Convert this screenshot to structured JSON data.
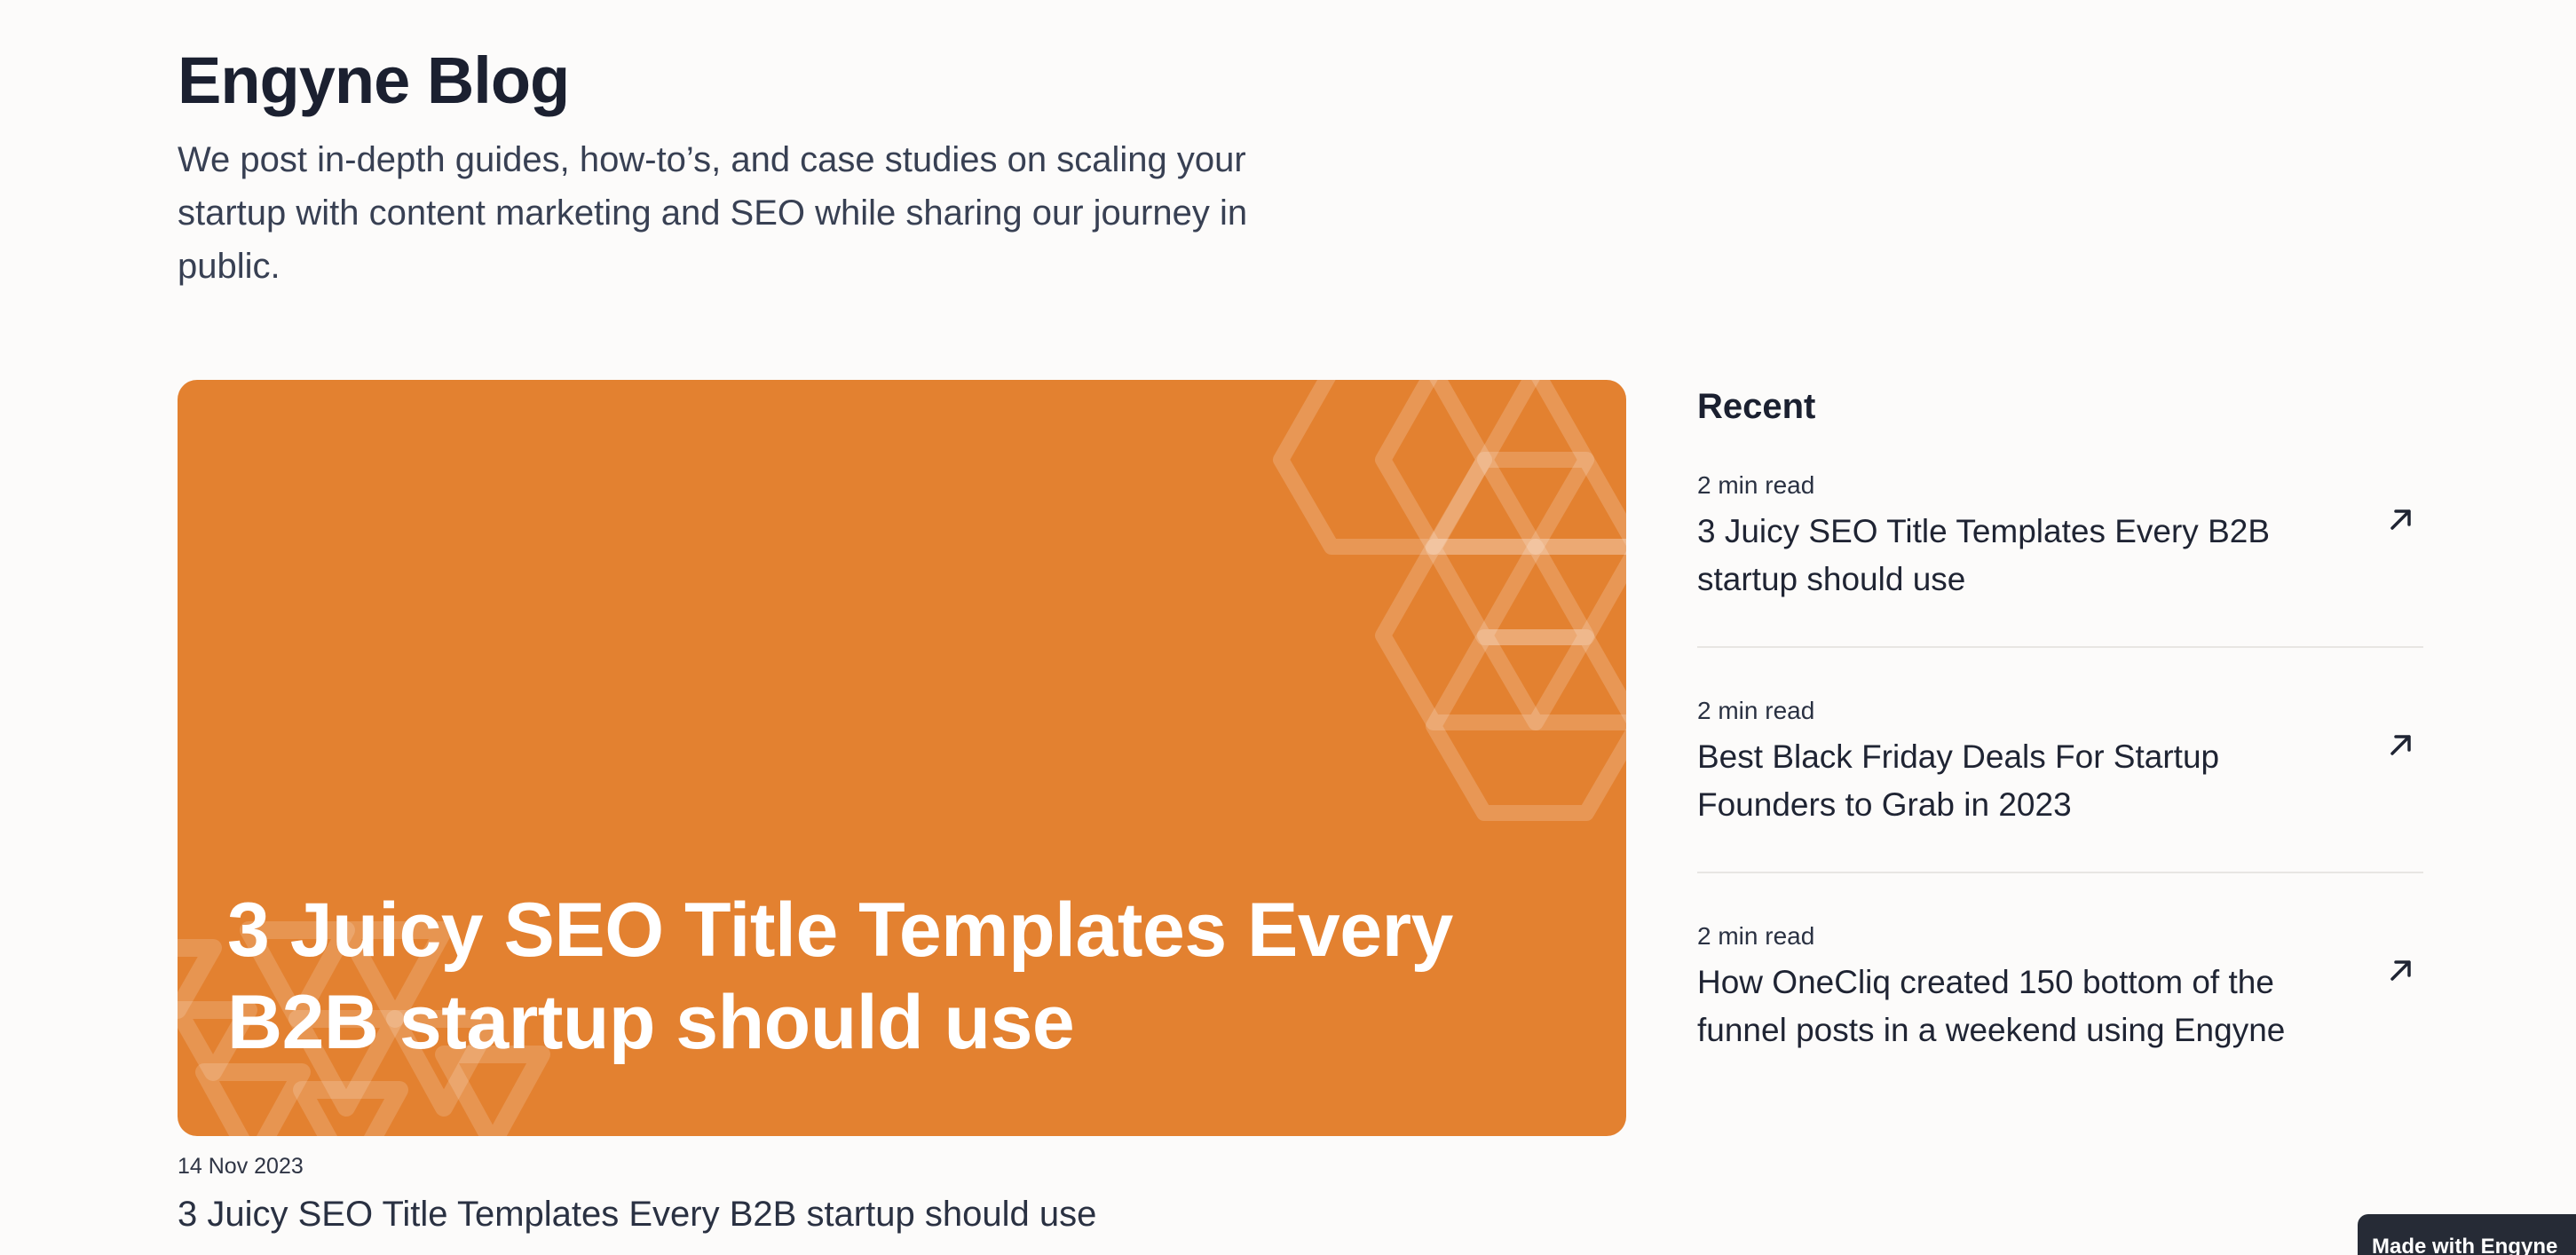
{
  "blog": {
    "title": "Engyne Blog",
    "description": "We post in-depth guides, how-to’s, and case studies on scaling your startup with content marketing and SEO while sharing our journey in public."
  },
  "featured": {
    "banner_title": "3 Juicy SEO Title Templates Every B2B startup should use",
    "date": "14 Nov 2023",
    "title": "3 Juicy SEO Title Templates Every B2B startup should use",
    "banner_color": "#e38130"
  },
  "recent": {
    "heading": "Recent",
    "items": [
      {
        "read_time": "2 min read",
        "title": "3 Juicy SEO Title Templates Every B2B startup should use",
        "icon": "arrow-up-right-icon"
      },
      {
        "read_time": "2 min read",
        "title": "Best Black Friday Deals For Startup Founders to Grab in 2023",
        "icon": "arrow-up-right-icon"
      },
      {
        "read_time": "2 min read",
        "title": "How OneCliq created 150 bottom of the funnel posts in a weekend using Engyne",
        "icon": "arrow-up-right-icon"
      }
    ]
  },
  "badge": {
    "label": "Made with Engyne"
  }
}
